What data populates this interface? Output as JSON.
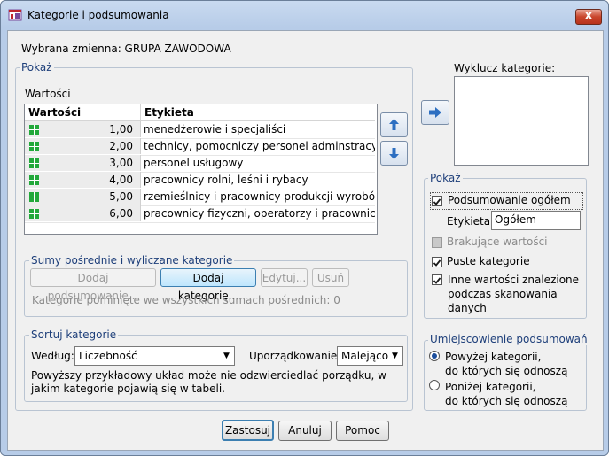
{
  "window": {
    "title": "Kategorie i podsumowania",
    "close_label": "X"
  },
  "header": {
    "selected_variable": "Wybrana zmienna: GRUPA ZAWODOWA"
  },
  "show_group": {
    "legend": "Pokaż",
    "values_label": "Wartości",
    "table": {
      "columns": [
        "Wartości",
        "Etykieta"
      ],
      "rows": [
        {
          "value": "1,00",
          "label": "menedżerowie i specjaliści"
        },
        {
          "value": "2,00",
          "label": "technicy, pomocniczy personel adminstracyjn..."
        },
        {
          "value": "3,00",
          "label": "personel usługowy"
        },
        {
          "value": "4,00",
          "label": "pracownicy rolni, leśni i rybacy"
        },
        {
          "value": "5,00",
          "label": "rzemieślnicy i pracownicy produkcji wyrobów ..."
        },
        {
          "value": "6,00",
          "label": "pracownicy fizyczni, operatorzy i pracownicy pr..."
        }
      ]
    }
  },
  "subtotals": {
    "legend": "Sumy pośrednie i wyliczane kategorie",
    "add_subtotal": "Dodaj podsumowanie...",
    "add_category": "Dodaj kategorię...",
    "edit": "Edytuj...",
    "remove": "Usuń",
    "note": "Kategorie pominięte we wszystkich sumach pośrednich: 0"
  },
  "sort": {
    "legend": "Sortuj kategorie",
    "by_label": "Według:",
    "by_value": "Liczebność",
    "order_label": "Uporządkowanie:",
    "order_value": "Malejąco",
    "note": "Powyższy przykładowy układ może nie odzwierciedlać porządku, w jakim kategorie pojawią się w tabeli."
  },
  "exclude": {
    "label": "Wyklucz kategorie:"
  },
  "show_right": {
    "legend": "Pokaż",
    "total_label": "Podsumowanie ogółem",
    "total_checked": true,
    "label_caption": "Etykieta:",
    "label_value": "Ogółem",
    "missing_label": "Brakujące wartości",
    "missing_checked": false,
    "empty_label": "Puste kategorie",
    "empty_checked": true,
    "other_line1": "Inne wartości znalezione",
    "other_line2": "podczas skanowania",
    "other_line3": "danych",
    "other_checked": true
  },
  "placement": {
    "legend": "Umiejscowienie podsumowań",
    "above_line1": "Powyżej kategorii,",
    "above_line2": "do których się odnoszą",
    "below_line1": "Poniżej kategorii,",
    "below_line2": "do których się odnoszą",
    "selected": "above"
  },
  "footer": {
    "apply": "Zastosuj",
    "cancel": "Anuluj",
    "help": "Pomoc"
  },
  "colors": {
    "accent": "#3c7fb1",
    "grid_icon": "#22a83a",
    "arrow_blue": "#2d6fc1",
    "legend": "#1e3f7a"
  }
}
